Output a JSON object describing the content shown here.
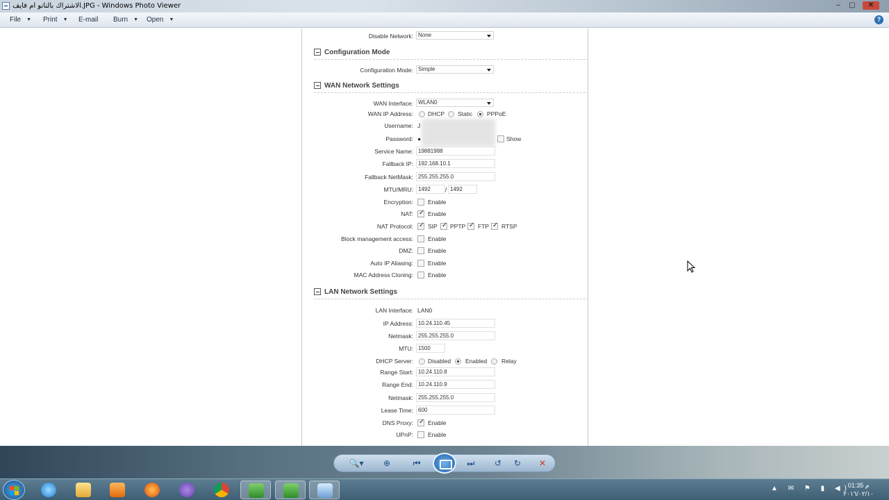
{
  "window": {
    "title": "الاشتراك بالنانو ام فايف.JPG - Windows Photo Viewer",
    "min_glyph": "‒",
    "max_glyph": "▢",
    "close_glyph": "✕"
  },
  "menu": {
    "file": "File",
    "print": "Print",
    "email": "E-mail",
    "burn": "Burn",
    "open": "Open",
    "help_glyph": "?"
  },
  "form": {
    "disable_network": {
      "label": "Disable Network:",
      "value": "None"
    },
    "sections": {
      "config": "Configuration Mode",
      "wan": "WAN Network Settings",
      "lan": "LAN Network Settings"
    },
    "configuration_mode": {
      "label": "Configuration Mode:",
      "value": "Simple"
    },
    "wan": {
      "interface": {
        "label": "WAN Interface:",
        "value": "WLAN0"
      },
      "ip_address": {
        "label": "WAN IP Address:",
        "options": [
          "DHCP",
          "Static",
          "PPPoE"
        ],
        "selected": "PPPoE"
      },
      "username": {
        "label": "Username:",
        "value": "J"
      },
      "password": {
        "label": "Password:",
        "value": "●",
        "show_label": "Show"
      },
      "service_name": {
        "label": "Service Name:",
        "value": "19881988"
      },
      "fallback_ip": {
        "label": "Fallback IP:",
        "value": "192.168.10.1"
      },
      "fallback_netmask": {
        "label": "Fallback NetMask:",
        "value": "255.255.255.0"
      },
      "mtu_mru": {
        "label": "MTU/MRU:",
        "mtu": "1492",
        "separator": "/",
        "mru": "1492"
      },
      "encryption": {
        "label": "Encryption:",
        "option": "Enable",
        "checked": false
      },
      "nat": {
        "label": "NAT:",
        "option": "Enable",
        "checked": true
      },
      "nat_protocol": {
        "label": "NAT Protocol:",
        "items": [
          "SIP",
          "PPTP",
          "FTP",
          "RTSP"
        ]
      },
      "block_mgmt": {
        "label": "Block management access:",
        "option": "Enable",
        "checked": false
      },
      "dmz": {
        "label": "DMZ:",
        "option": "Enable",
        "checked": false
      },
      "auto_ip_aliasing": {
        "label": "Auto IP Aliasing:",
        "option": "Enable",
        "checked": false
      },
      "mac_cloning": {
        "label": "MAC Address Cloning:",
        "option": "Enable",
        "checked": false
      }
    },
    "lan": {
      "interface": {
        "label": "LAN Interface:",
        "value": "LAN0"
      },
      "ip_address": {
        "label": "IP Address:",
        "value": "10.24.110.45"
      },
      "netmask": {
        "label": "Netmask:",
        "value": "255.255.255.0"
      },
      "mtu": {
        "label": "MTU:",
        "value": "1500"
      },
      "dhcp_server": {
        "label": "DHCP Server:",
        "options": [
          "Disabled",
          "Enabled",
          "Relay"
        ],
        "selected": "Enabled"
      },
      "range_start": {
        "label": "Range Start:",
        "value": "10.24.110.8"
      },
      "range_end": {
        "label": "Range End:",
        "value": "10.24.110.9"
      },
      "dhcp_netmask": {
        "label": "Netmask:",
        "value": "255.255.255.0"
      },
      "lease_time": {
        "label": "Lease Time:",
        "value": "600"
      },
      "dns_proxy": {
        "label": "DNS Proxy:",
        "option": "Enable",
        "checked": true
      },
      "upnp": {
        "label": "UPnP:",
        "option": "Enable",
        "checked": false
      }
    }
  },
  "controls": {
    "zoom_glyph": "🔍▾",
    "actual_size_glyph": "⊕",
    "prev_glyph": "⏮",
    "next_glyph": "⏭",
    "rotate_left_glyph": "↺",
    "rotate_right_glyph": "↻",
    "delete_glyph": "✕"
  },
  "taskbar": {
    "tray_icons": "▲ ✉ ⚑ ▮ ◀)",
    "time": "01:35 م",
    "date": "٢٠١٦/٠٢/١٠"
  },
  "icons": {
    "collapse": "collapse-icon",
    "cursor": "mouse-pointer-icon",
    "start": "windows-start-icon"
  }
}
